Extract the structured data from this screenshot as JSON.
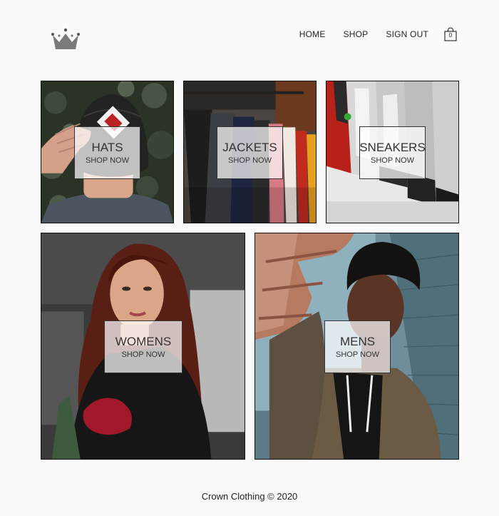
{
  "header": {
    "logo_icon": "crown-icon",
    "nav": [
      {
        "label": "HOME"
      },
      {
        "label": "SHOP"
      },
      {
        "label": "SIGN OUT"
      }
    ],
    "cart": {
      "icon": "shopping-bag-icon",
      "count": "0"
    }
  },
  "categories": [
    {
      "title": "HATS",
      "subtitle": "SHOP NOW"
    },
    {
      "title": "JACKETS",
      "subtitle": "SHOP NOW"
    },
    {
      "title": "SNEAKERS",
      "subtitle": "SHOP NOW"
    },
    {
      "title": "WOMENS",
      "subtitle": "SHOP NOW"
    },
    {
      "title": "MENS",
      "subtitle": "SHOP NOW"
    }
  ],
  "footer": {
    "text": "Crown Clothing © 2020"
  }
}
